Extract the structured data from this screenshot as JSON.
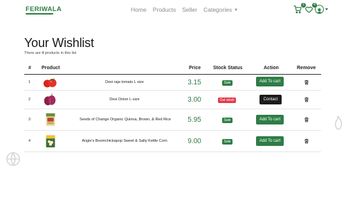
{
  "brand": {
    "name": "FERIWALA"
  },
  "nav": {
    "links": [
      "Home",
      "Products",
      "Seller"
    ],
    "categories_label": "Categories",
    "cart_count": "2",
    "wishlist_count": "4"
  },
  "wishlist": {
    "title": "Your Wishlist",
    "subtitle_prefix": "There are ",
    "count": "4",
    "subtitle_suffix": " products in this list",
    "columns": [
      "#",
      "Product",
      "Price",
      "Stock Status",
      "Action",
      "Remove"
    ]
  },
  "items": [
    {
      "index": "1",
      "name": "Desi raja tomato L size",
      "price": "3.15",
      "status": "Sale",
      "status_type": "sale",
      "action": "Add To cart",
      "thumb": "tomato"
    },
    {
      "index": "2",
      "name": "Desi Onion L-size",
      "price": "3.00",
      "status": "Out stock",
      "status_type": "out",
      "action": "Contact",
      "thumb": "onion"
    },
    {
      "index": "3",
      "name": "Seeds of Change Organic Quinoa, Brown, & Red Rice",
      "price": "5.95",
      "status": "Sale",
      "status_type": "sale",
      "action": "Add To cart",
      "thumb": "quinoa"
    },
    {
      "index": "4",
      "name": "Angie's Boomchickapop Sweet & Salty Kettle Corn",
      "price": "9.00",
      "status": "Sale",
      "status_type": "sale",
      "action": "Add To cart",
      "thumb": "popcorn"
    }
  ],
  "colors": {
    "brand_green": "#2e7d46",
    "out_red": "#e3394a",
    "contact_black": "#1c1c1c"
  },
  "icons": {
    "cart": "cart-icon",
    "wishlist": "heart-icon",
    "user": "user-avatar-icon",
    "remove": "trash-icon"
  }
}
